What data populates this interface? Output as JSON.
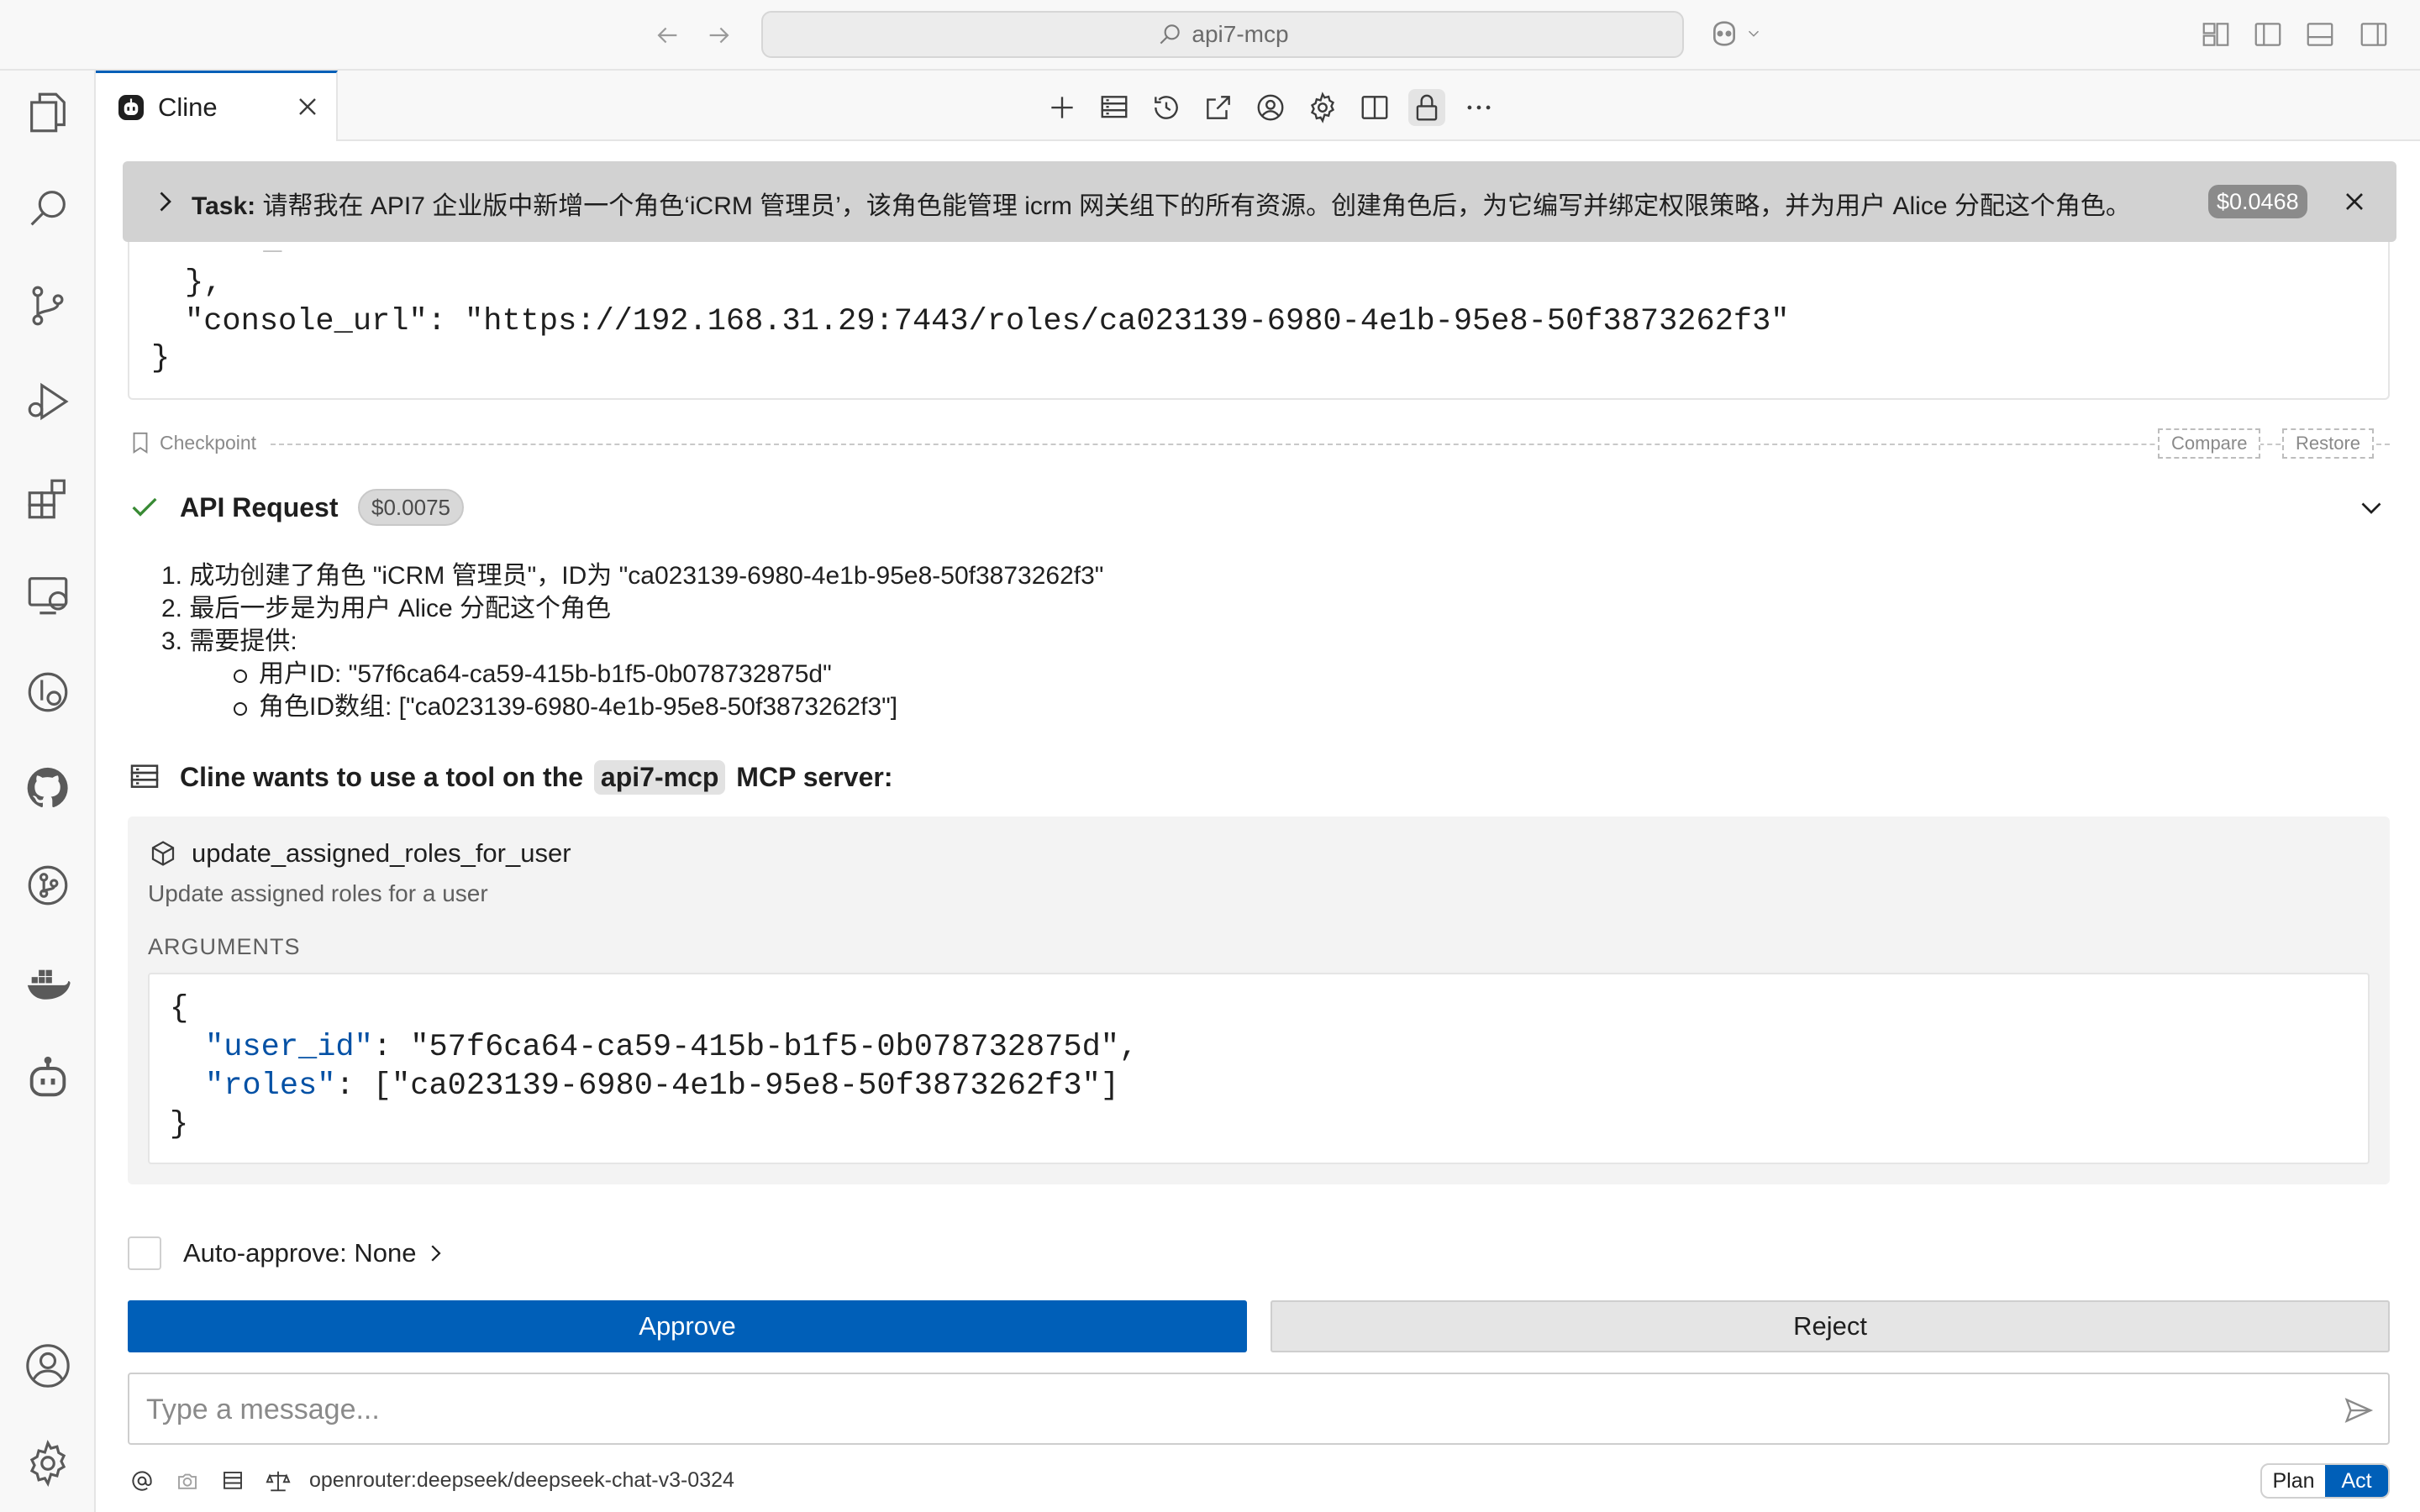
{
  "titlebar": {
    "search_text": "api7-mcp"
  },
  "tab": {
    "label": "Cline"
  },
  "task": {
    "prefix": "Task:",
    "text": "请帮我在 API7 企业版中新增一个角色‘iCRM 管理员’，该角色能管理 icrm 网关组下的所有资源。创建角色后，为它编写并绑定权限策略，并为用户 Alice 分配这个角色。",
    "cost": "$0.0468"
  },
  "code_top": {
    "line1": "},",
    "line2": "\"console_url\": \"https://192.168.31.29:7443/roles/ca023139-6980-4e1b-95e8-50f3873262f3\"",
    "line3": "}"
  },
  "checkpoint": {
    "label": "Checkpoint",
    "compare": "Compare",
    "restore": "Restore"
  },
  "api_request": {
    "title": "API Request",
    "cost": "$0.0075"
  },
  "steps": [
    "1. 成功创建了角色 \"iCRM 管理员\"，ID为 \"ca023139-6980-4e1b-95e8-50f3873262f3\"",
    "2. 最后一步是为用户 Alice 分配这个角色",
    "3. 需要提供:"
  ],
  "sub_steps": [
    "用户ID: \"57f6ca64-ca59-415b-b1f5-0b078732875d\"",
    "角色ID数组: [\"ca023139-6980-4e1b-95e8-50f3873262f3\"]"
  ],
  "mcp": {
    "prefix": "Cline wants to use a tool on the",
    "server": "api7-mcp",
    "suffix": "MCP server:",
    "tool_name": "update_assigned_roles_for_user",
    "tool_desc": "Update assigned roles for a user",
    "args_label": "ARGUMENTS",
    "arg_open": "{",
    "arg_key1": "\"user_id\"",
    "arg_val1": ": \"57f6ca64-ca59-415b-b1f5-0b078732875d\",",
    "arg_key2": "\"roles\"",
    "arg_val2": ": [\"ca023139-6980-4e1b-95e8-50f3873262f3\"]",
    "arg_close": "}"
  },
  "auto_approve": {
    "label": "Auto-approve: None"
  },
  "buttons": {
    "approve": "Approve",
    "reject": "Reject"
  },
  "message": {
    "placeholder": "Type a message..."
  },
  "bottom": {
    "model": "openrouter:deepseek/deepseek-chat-v3-0324",
    "plan": "Plan",
    "act": "Act"
  },
  "colors": {
    "accent": "#005fb8",
    "json_key": "#0451a5",
    "success": "#388a34"
  }
}
